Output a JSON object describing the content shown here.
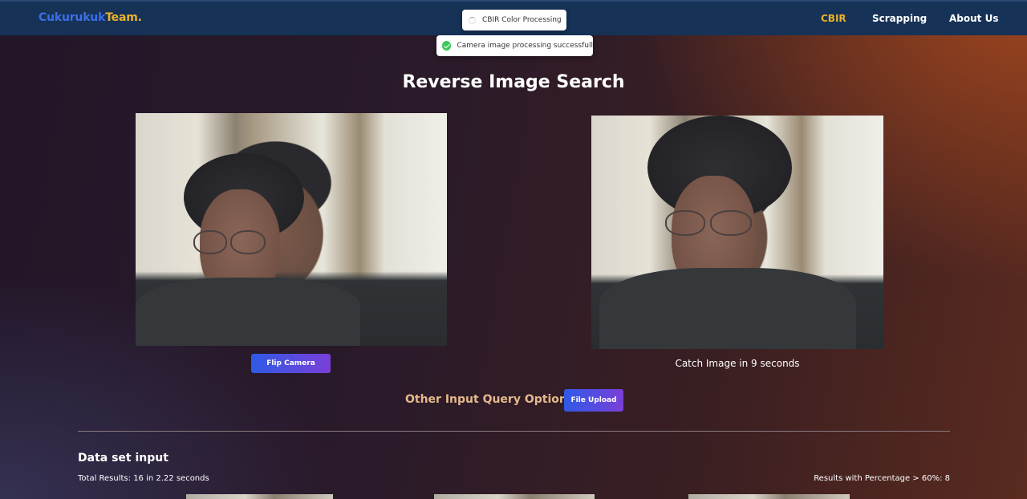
{
  "navbar": {
    "logo_part1": "Cukurukuk",
    "logo_part2": "Team.",
    "links": [
      {
        "label": "CBIR",
        "active": true
      },
      {
        "label": "Scrapping",
        "active": false
      },
      {
        "label": "About Us",
        "active": false
      }
    ]
  },
  "toasts": {
    "loading": "CBIR Color Processing",
    "success": "Camera image processing successfull"
  },
  "page": {
    "title": "Reverse Image Search",
    "flip_button": "Flip Camera",
    "capture_caption": "Catch Image in 9 seconds",
    "other_input_label": "Other Input Query Option:",
    "file_upload_button": "File Upload"
  },
  "dataset": {
    "title": "Data set input",
    "total_results": "Total Results: 16 in 2.22 seconds",
    "percentage_results": "Results with Percentage > 60%: 8"
  },
  "colors": {
    "navbar": "#163257",
    "accent_gold": "#e9b02a",
    "logo_blue": "#3d6ee6",
    "success_green": "#3cc85a"
  }
}
